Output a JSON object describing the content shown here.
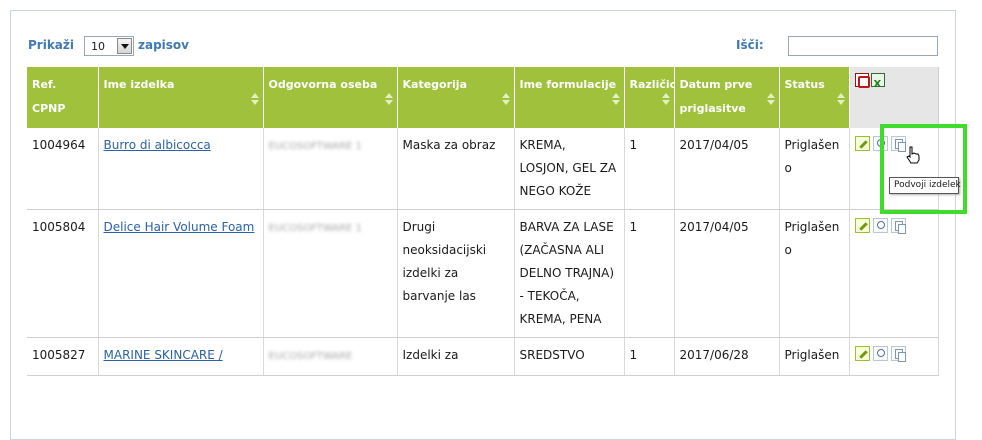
{
  "controls": {
    "show_label": "Prikaži",
    "page_size": "10",
    "records_label": "zapisov",
    "search_label": "Išči:",
    "search_value": ""
  },
  "columns": [
    "Ref. CPNP",
    "Ime izdelka",
    "Odgovorna oseba",
    "Kategorija",
    "Ime formulacije",
    "Različica",
    "Datum prve priglasitve",
    "Status"
  ],
  "export_icons": [
    "pdf-export-icon",
    "excel-export-icon"
  ],
  "rows": [
    {
      "ref": "1004964",
      "product": "Burro di albicocca",
      "person": "EUCOSOFTWARE 1",
      "category": "Maska za obraz",
      "formulation": "KREMA, LOSJON, GEL ZA NEGO KOŽE",
      "version": "1",
      "date": "2017/04/05",
      "status": "Priglašen o"
    },
    {
      "ref": "1005804",
      "product": "Delice Hair Volume Foam",
      "person": "EUCOSOFTWARE 1",
      "category": "Drugi neoksidacijski izdelki za barvanje las",
      "formulation": "BARVA ZA LASE (ZAČASNA ALI DELNO TRAJNA) - TEKOČA, KREMA, PENA",
      "version": "1",
      "date": "2017/04/05",
      "status": "Priglašen o"
    },
    {
      "ref": "1005827",
      "product": "MARINE SKINCARE /",
      "person": "EUCOSOFTWARE",
      "category": "Izdelki za",
      "formulation": "SREDSTVO",
      "version": "1",
      "date": "2017/06/28",
      "status": "Priglašen"
    }
  ],
  "tooltip": "Podvoji izdelek",
  "colors": {
    "header_green": "#9fc13b",
    "link_blue": "#2b62a6",
    "highlight_green": "#3fdc2b"
  }
}
